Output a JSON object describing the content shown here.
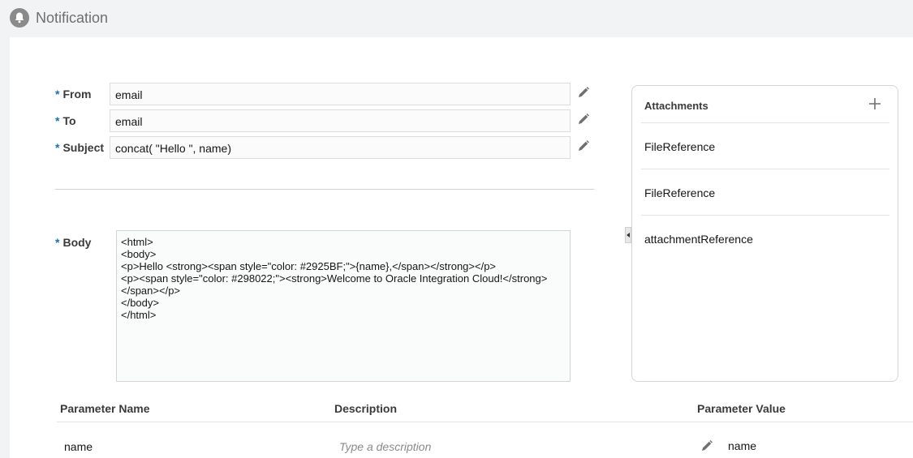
{
  "header": {
    "title": "Notification",
    "icon": "bell-icon"
  },
  "form": {
    "from": {
      "label": "From",
      "value": "email"
    },
    "to": {
      "label": "To",
      "value": "email"
    },
    "subject": {
      "label": "Subject",
      "value": "concat( \"Hello \", name)"
    },
    "body": {
      "label": "Body",
      "lines": [
        "<html>",
        "<body>",
        "<p>Hello <strong><span style=\"color: #2925BF;\">{name},</span></strong></p>",
        "<p><span style=\"color: #298022;\"><strong>Welcome to Oracle Integration Cloud!</strong>",
        "</span></p>",
        "</body>",
        "</html>"
      ]
    },
    "required_mark": "*"
  },
  "attachments": {
    "title": "Attachments",
    "items": [
      "FileReference",
      "FileReference",
      "attachmentReference"
    ]
  },
  "parameters": {
    "headers": {
      "name": "Parameter Name",
      "description": "Description",
      "value": "Parameter Value"
    },
    "rows": [
      {
        "name": "name",
        "description_placeholder": "Type a description",
        "value": "name"
      }
    ]
  },
  "colors": {
    "required": "#1d6fb8",
    "header_bg": "#f2f3f4"
  }
}
